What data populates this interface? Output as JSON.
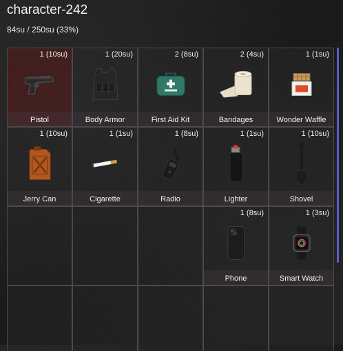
{
  "inventory": {
    "title": "character-242",
    "capacity": "84su / 250su (33%)"
  },
  "colors": {
    "scrollbar": "#5c5ccc",
    "selected_slot": "#5a1919"
  },
  "slots": [
    {
      "name": "Pistol",
      "qty": "1 (10su)",
      "icon": "pistol-icon",
      "selected": true
    },
    {
      "name": "Body Armor",
      "qty": "1 (20su)",
      "icon": "body-armor-icon"
    },
    {
      "name": "First Aid Kit",
      "qty": "2 (8su)",
      "icon": "first-aid-kit-icon"
    },
    {
      "name": "Bandages",
      "qty": "2 (4su)",
      "icon": "bandages-icon"
    },
    {
      "name": "Wonder Waffle",
      "qty": "1 (1su)",
      "icon": "waffle-icon"
    },
    {
      "name": "Jerry Can",
      "qty": "1 (10su)",
      "icon": "jerry-can-icon"
    },
    {
      "name": "Cigarette",
      "qty": "1 (1su)",
      "icon": "cigarette-icon"
    },
    {
      "name": "Radio",
      "qty": "1 (8su)",
      "icon": "radio-icon"
    },
    {
      "name": "Lighter",
      "qty": "1 (1su)",
      "icon": "lighter-icon"
    },
    {
      "name": "Shovel",
      "qty": "1 (10su)",
      "icon": "shovel-icon"
    },
    null,
    null,
    null,
    {
      "name": "Phone",
      "qty": "1 (8su)",
      "icon": "phone-icon"
    },
    {
      "name": "Smart Watch",
      "qty": "1 (3su)",
      "icon": "smart-watch-icon"
    },
    null,
    null,
    null,
    null,
    null
  ]
}
